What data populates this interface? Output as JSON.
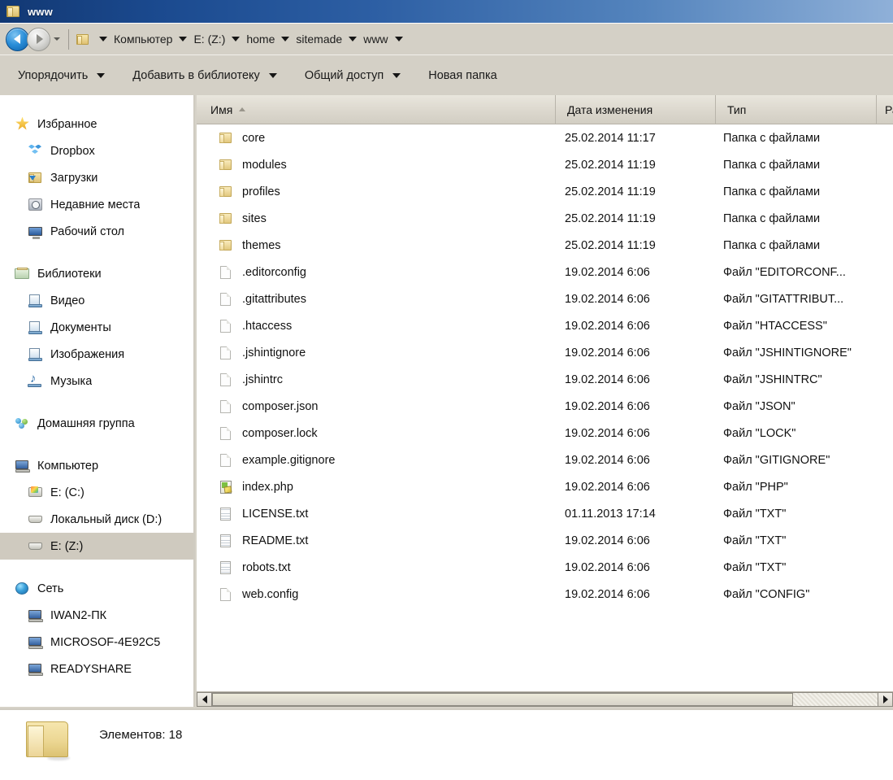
{
  "window": {
    "title": "www",
    "folder_icon": "folder-icon"
  },
  "address_bar": {
    "back_icon": "back-arrow-icon",
    "forward_icon": "forward-arrow-icon",
    "history_icon": "chevron-down-icon",
    "folder_icon": "folder-icon",
    "breadcrumbs": [
      "Компьютер",
      "E: (Z:)",
      "home",
      "sitemade",
      "www"
    ]
  },
  "toolbar": {
    "items": [
      {
        "label": "Упорядочить",
        "has_caret": true
      },
      {
        "label": "Добавить в библиотеку",
        "has_caret": true
      },
      {
        "label": "Общий доступ",
        "has_caret": true
      },
      {
        "label": "Новая папка",
        "has_caret": false
      }
    ]
  },
  "sidebar": {
    "groups": [
      {
        "header": {
          "label": "Избранное",
          "icon": "star-icon"
        },
        "items": [
          {
            "label": "Dropbox",
            "icon": "dropbox-icon",
            "selected": false
          },
          {
            "label": "Загрузки",
            "icon": "downloads-folder-icon",
            "selected": false
          },
          {
            "label": "Недавние места",
            "icon": "recent-places-icon",
            "selected": false
          },
          {
            "label": "Рабочий стол",
            "icon": "desktop-icon",
            "selected": false
          }
        ]
      },
      {
        "header": {
          "label": "Библиотеки",
          "icon": "libraries-icon"
        },
        "items": [
          {
            "label": "Видео",
            "icon": "video-library-icon",
            "selected": false
          },
          {
            "label": "Документы",
            "icon": "documents-library-icon",
            "selected": false
          },
          {
            "label": "Изображения",
            "icon": "pictures-library-icon",
            "selected": false
          },
          {
            "label": "Музыка",
            "icon": "music-library-icon",
            "selected": false
          }
        ]
      },
      {
        "header": {
          "label": "Домашняя группа",
          "icon": "homegroup-icon"
        },
        "items": []
      },
      {
        "header": {
          "label": "Компьютер",
          "icon": "computer-icon"
        },
        "items": [
          {
            "label": "E: (C:)",
            "icon": "windows-drive-icon",
            "selected": false
          },
          {
            "label": "Локальный диск (D:)",
            "icon": "drive-icon",
            "selected": false
          },
          {
            "label": "E: (Z:)",
            "icon": "drive-icon",
            "selected": true
          }
        ]
      },
      {
        "header": {
          "label": "Сеть",
          "icon": "network-icon"
        },
        "items": [
          {
            "label": "IWAN2-ПК",
            "icon": "computer-icon",
            "selected": false
          },
          {
            "label": "MICROSOF-4E92C5",
            "icon": "computer-icon",
            "selected": false
          },
          {
            "label": "READYSHARE",
            "icon": "computer-icon",
            "selected": false
          }
        ]
      }
    ]
  },
  "file_list": {
    "columns": [
      {
        "label": "Имя",
        "sorted": true,
        "sort_icon": "sort-ascending-icon"
      },
      {
        "label": "Дата изменения",
        "sorted": false
      },
      {
        "label": "Тип",
        "sorted": false
      },
      {
        "label": "Ра",
        "sorted": false
      }
    ],
    "rows": [
      {
        "name": "core",
        "date": "25.02.2014 11:17",
        "type": "Папка с файлами",
        "icon": "folder-icon"
      },
      {
        "name": "modules",
        "date": "25.02.2014 11:19",
        "type": "Папка с файлами",
        "icon": "folder-icon"
      },
      {
        "name": "profiles",
        "date": "25.02.2014 11:19",
        "type": "Папка с файлами",
        "icon": "folder-icon"
      },
      {
        "name": "sites",
        "date": "25.02.2014 11:19",
        "type": "Папка с файлами",
        "icon": "folder-icon"
      },
      {
        "name": "themes",
        "date": "25.02.2014 11:19",
        "type": "Папка с файлами",
        "icon": "folder-icon"
      },
      {
        "name": ".editorconfig",
        "date": "19.02.2014 6:06",
        "type": "Файл \"EDITORCONF...",
        "icon": "blank-file-icon"
      },
      {
        "name": ".gitattributes",
        "date": "19.02.2014 6:06",
        "type": "Файл \"GITATTRIBUT...",
        "icon": "blank-file-icon"
      },
      {
        "name": ".htaccess",
        "date": "19.02.2014 6:06",
        "type": "Файл \"HTACCESS\"",
        "icon": "blank-file-icon"
      },
      {
        "name": ".jshintignore",
        "date": "19.02.2014 6:06",
        "type": "Файл \"JSHINTIGNORE\"",
        "icon": "blank-file-icon"
      },
      {
        "name": ".jshintrc",
        "date": "19.02.2014 6:06",
        "type": "Файл \"JSHINTRC\"",
        "icon": "blank-file-icon"
      },
      {
        "name": "composer.json",
        "date": "19.02.2014 6:06",
        "type": "Файл \"JSON\"",
        "icon": "blank-file-icon"
      },
      {
        "name": "composer.lock",
        "date": "19.02.2014 6:06",
        "type": "Файл \"LOCK\"",
        "icon": "blank-file-icon"
      },
      {
        "name": "example.gitignore",
        "date": "19.02.2014 6:06",
        "type": "Файл \"GITIGNORE\"",
        "icon": "blank-file-icon"
      },
      {
        "name": "index.php",
        "date": "19.02.2014 6:06",
        "type": "Файл \"PHP\"",
        "icon": "php-file-icon"
      },
      {
        "name": "LICENSE.txt",
        "date": "01.11.2013 17:14",
        "type": "Файл \"TXT\"",
        "icon": "text-file-icon"
      },
      {
        "name": "README.txt",
        "date": "19.02.2014 6:06",
        "type": "Файл \"TXT\"",
        "icon": "text-file-icon"
      },
      {
        "name": "robots.txt",
        "date": "19.02.2014 6:06",
        "type": "Файл \"TXT\"",
        "icon": "text-file-icon"
      },
      {
        "name": "web.config",
        "date": "19.02.2014 6:06",
        "type": "Файл \"CONFIG\"",
        "icon": "blank-file-icon"
      }
    ]
  },
  "scrollbar": {
    "left_icon": "scroll-left-icon",
    "right_icon": "scroll-right-icon"
  },
  "status_bar": {
    "folder_icon": "large-folder-icon",
    "text": "Элементов: 18"
  },
  "colors": {
    "titlebar_start": "#123873",
    "titlebar_end": "#8fb0d8",
    "chrome": "#d4d0c6",
    "selection": "#cfcabf",
    "header": "#ddd9cf"
  }
}
